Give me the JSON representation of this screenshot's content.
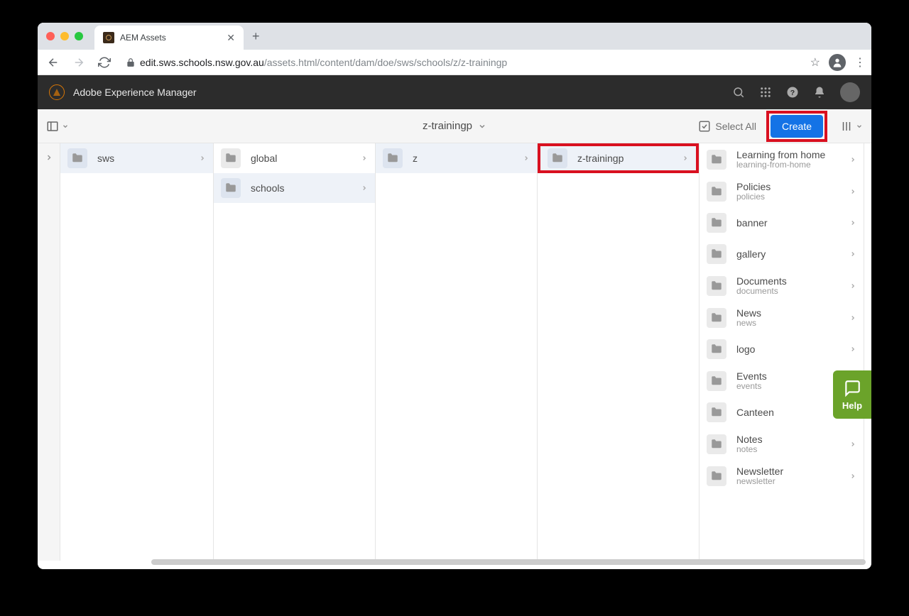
{
  "browser": {
    "tab_title": "AEM Assets",
    "url_host": "edit.sws.schools.nsw.gov.au",
    "url_path": "/assets.html/content/dam/doe/sws/schools/z/z-trainingp"
  },
  "aem_header": {
    "title": "Adobe Experience Manager"
  },
  "toolbar": {
    "breadcrumb_label": "z-trainingp",
    "select_all_label": "Select All",
    "create_label": "Create"
  },
  "columns": {
    "col1": [
      {
        "label": "sws",
        "active": true
      }
    ],
    "col2": [
      {
        "label": "global",
        "active": false
      },
      {
        "label": "schools",
        "active": true
      }
    ],
    "col3": [
      {
        "label": "z",
        "active": true
      }
    ],
    "col4": [
      {
        "label": "z-trainingp",
        "active": true,
        "highlighted": true
      }
    ],
    "col5": [
      {
        "label": "Learning from home",
        "subtitle": "learning-from-home"
      },
      {
        "label": "Policies",
        "subtitle": "policies"
      },
      {
        "label": "banner"
      },
      {
        "label": "gallery"
      },
      {
        "label": "Documents",
        "subtitle": "documents"
      },
      {
        "label": "News",
        "subtitle": "news"
      },
      {
        "label": "logo"
      },
      {
        "label": "Events",
        "subtitle": "events"
      },
      {
        "label": "Canteen"
      },
      {
        "label": "Notes",
        "subtitle": "notes"
      },
      {
        "label": "Newsletter",
        "subtitle": "newsletter"
      }
    ]
  },
  "help_widget": {
    "label": "Help"
  }
}
